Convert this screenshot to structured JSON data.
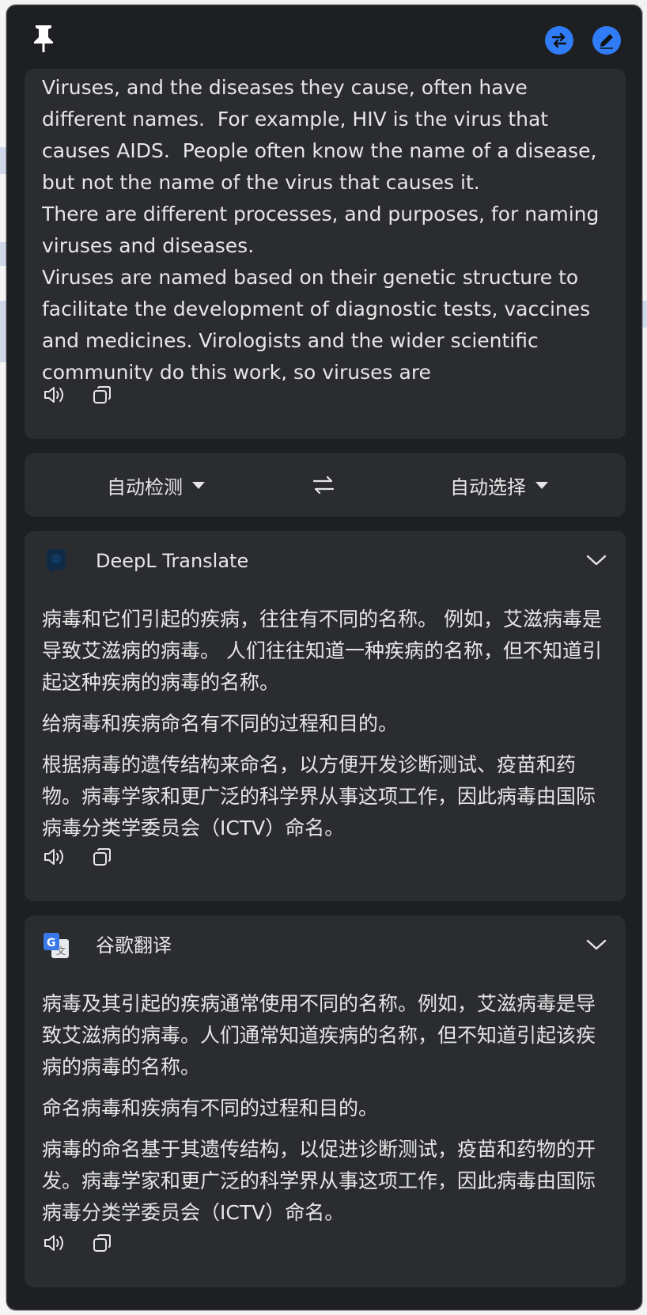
{
  "colors": {
    "window_bg": "#1d1f22",
    "card_bg": "#2a2c30",
    "accent": "#2f7cf6",
    "text": "#e6e6e6"
  },
  "titlebar": {
    "pin_icon": "pin-icon",
    "swap_icon": "swap-arrows-icon",
    "edit_icon": "pencil-icon"
  },
  "source": {
    "text": "Viruses, and the diseases they cause, often have different names.  For example, HIV is the virus that causes AIDS.  People often know the name of a disease, but not the name of the virus that causes it.\nThere are different processes, and purposes, for naming viruses and diseases.\nViruses are named based on their genetic structure to facilitate the development of diagnostic tests, vaccines and medicines. Virologists and the wider scientific community do this work, so viruses are",
    "speak_icon": "speaker-icon",
    "copy_icon": "copy-icon"
  },
  "language_bar": {
    "from_label": "自动检测",
    "to_label": "自动选择",
    "swap_icon": "swap-arrows-icon"
  },
  "results": [
    {
      "provider": "DeepL Translate",
      "logo_icon": "deepl-logo-icon",
      "paragraphs": [
        "病毒和它们引起的疾病，往往有不同的名称。 例如，艾滋病毒是导致艾滋病的病毒。 人们往往知道一种疾病的名称，但不知道引起这种疾病的病毒的名称。",
        "给病毒和疾病命名有不同的过程和目的。",
        "根据病毒的遗传结构来命名，以方便开发诊断测试、疫苗和药物。病毒学家和更广泛的科学界从事这项工作，因此病毒由国际病毒分类学委员会（ICTV）命名。"
      ]
    },
    {
      "provider": "谷歌翻译",
      "logo_icon": "google-translate-logo-icon",
      "paragraphs": [
        "病毒及其引起的疾病通常使用不同的名称。例如，艾滋病毒是导致艾滋病的病毒。人们通常知道疾病的名称，但不知道引起该疾病的病毒的名称。",
        "命名病毒和疾病有不同的过程和目的。",
        "病毒的命名基于其遗传结构，以促进诊断测试，疫苗和药物的开发。病毒学家和更广泛的科学界从事这项工作，因此病毒由国际病毒分类学委员会（ICTV）命名。"
      ]
    }
  ]
}
